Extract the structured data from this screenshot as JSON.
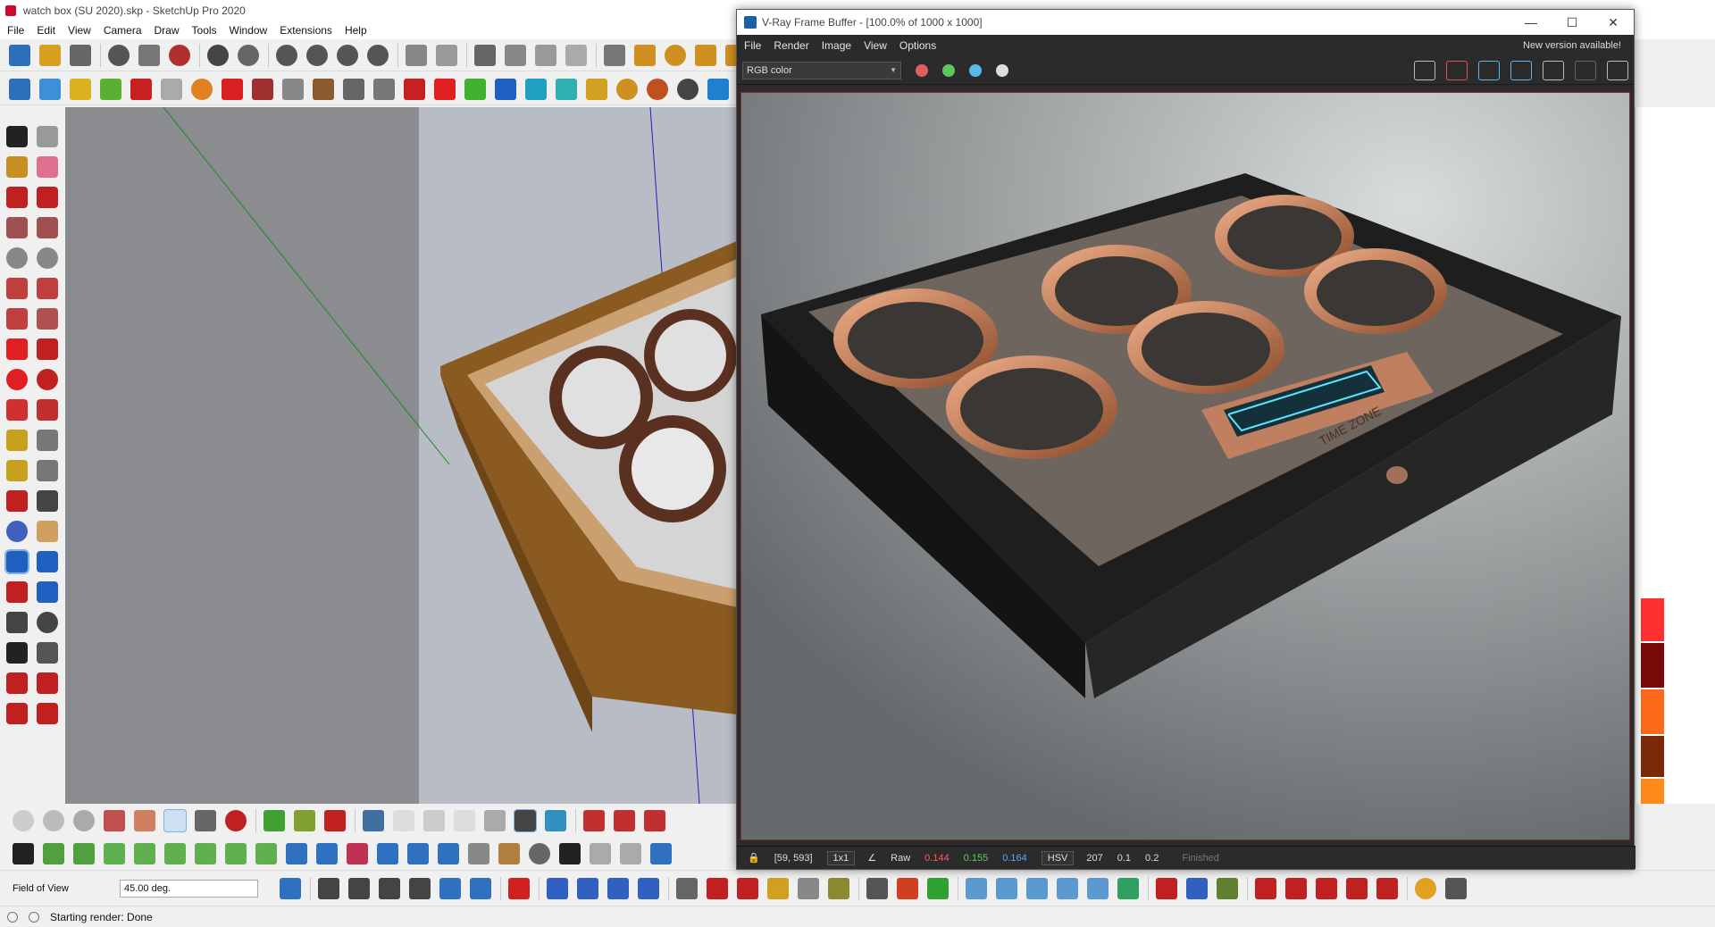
{
  "sketchup": {
    "title": "watch box (SU 2020).skp - SketchUp Pro 2020",
    "menu": [
      "File",
      "Edit",
      "View",
      "Camera",
      "Draw",
      "Tools",
      "Window",
      "Extensions",
      "Help"
    ],
    "measurements": {
      "label": "Field of View",
      "value": "45.00 deg."
    },
    "status": "Starting render: Done"
  },
  "vray": {
    "title": "V-Ray Frame Buffer - [100.0% of 1000 x 1000]",
    "menu": [
      "File",
      "Render",
      "Image",
      "View",
      "Options"
    ],
    "notice": "New version available!",
    "channel": "RGB color",
    "channel_dots": [
      "#e06060",
      "#5ac85a",
      "#5ab8ea",
      "#dddddd"
    ],
    "status": {
      "coords": "[59, 593]",
      "zoom": "1x1",
      "raw_label": "Raw",
      "r": "0.144",
      "g": "0.155",
      "b": "0.164",
      "mode": "HSV",
      "h": "207",
      "s": "0.1",
      "v": "0.2",
      "state": "Finished"
    },
    "render_text": "TIME ZONE"
  },
  "colors": {
    "wood": "#a8742e",
    "dark_box": "#1e1e1e",
    "copper": "#c8825a",
    "lcd": "#5ae6ff",
    "tray_swatches": [
      "#ff3030",
      "#7a0a0a",
      "#ff6a1a",
      "#7a2a0a",
      "#ff8a1a"
    ]
  }
}
